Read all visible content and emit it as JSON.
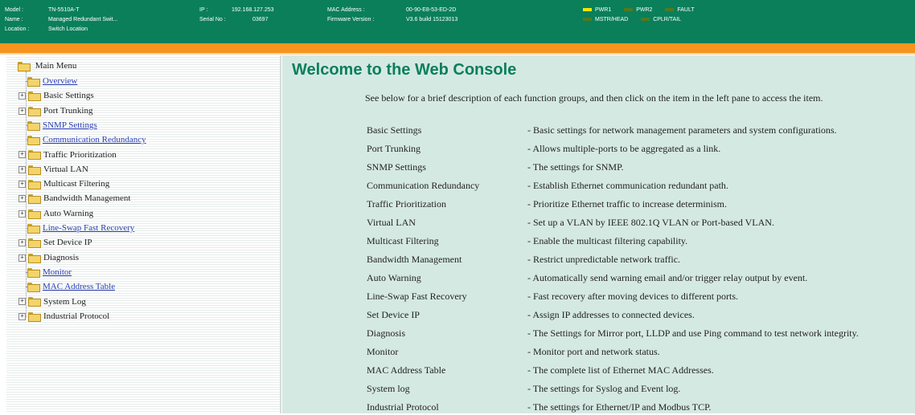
{
  "header": {
    "model_label": "Model :",
    "model_value": "TN-5510A-T",
    "name_label": "Name :",
    "name_value": "Managed Redundant Swit...",
    "location_label": "Location :",
    "location_value": "Switch Location",
    "ip_label": "IP :",
    "ip_value": "192.168.127.253",
    "serial_label": "Serial No :",
    "serial_value": "03697",
    "mac_label": "MAC Address :",
    "mac_value": "00-90-E8-53-ED-2D",
    "firmware_label": "Firmware Version :",
    "firmware_value": "V3.6 build 15123013",
    "leds": {
      "pwr1": {
        "label": "PWR1",
        "color": "#f2e600"
      },
      "pwr2": {
        "label": "PWR2",
        "color": "#4f7a20"
      },
      "fault": {
        "label": "FAULT",
        "color": "#4f7a20"
      },
      "mstr": {
        "label": "MSTR/HEAD",
        "color": "#4f7a20"
      },
      "cplr": {
        "label": "CPLR/TAIL",
        "color": "#4f7a20"
      }
    }
  },
  "sidebar": {
    "root_label": "Main Menu",
    "items": [
      {
        "label": "Overview",
        "expandable": false,
        "link": true
      },
      {
        "label": "Basic Settings",
        "expandable": true,
        "link": false
      },
      {
        "label": "Port Trunking",
        "expandable": true,
        "link": false
      },
      {
        "label": "SNMP Settings",
        "expandable": false,
        "link": true
      },
      {
        "label": "Communication Redundancy",
        "expandable": false,
        "link": true
      },
      {
        "label": "Traffic Prioritization",
        "expandable": true,
        "link": false
      },
      {
        "label": "Virtual LAN",
        "expandable": true,
        "link": false
      },
      {
        "label": "Multicast Filtering",
        "expandable": true,
        "link": false
      },
      {
        "label": "Bandwidth Management",
        "expandable": true,
        "link": false
      },
      {
        "label": "Auto Warning",
        "expandable": true,
        "link": false
      },
      {
        "label": "Line-Swap Fast Recovery",
        "expandable": false,
        "link": true
      },
      {
        "label": "Set Device IP",
        "expandable": true,
        "link": false
      },
      {
        "label": "Diagnosis",
        "expandable": true,
        "link": false
      },
      {
        "label": "Monitor",
        "expandable": false,
        "link": true
      },
      {
        "label": "MAC Address Table",
        "expandable": false,
        "link": true
      },
      {
        "label": "System Log",
        "expandable": true,
        "link": false
      },
      {
        "label": "Industrial Protocol",
        "expandable": true,
        "link": false
      }
    ]
  },
  "main": {
    "title": "Welcome to the Web Console",
    "intro": "See below for a brief description of each function groups, and then click on the item in the left pane to access the item.",
    "descriptions": [
      {
        "name": "Basic Settings",
        "text": "- Basic settings for network management parameters and system configurations."
      },
      {
        "name": "Port Trunking",
        "text": "- Allows multiple-ports to be aggregated as a link."
      },
      {
        "name": "SNMP Settings",
        "text": "- The settings for SNMP."
      },
      {
        "name": "Communication Redundancy",
        "text": "- Establish Ethernet communication redundant path."
      },
      {
        "name": "Traffic Prioritization",
        "text": "- Prioritize Ethernet traffic to increase determinism."
      },
      {
        "name": "Virtual LAN",
        "text": "- Set up a VLAN by IEEE 802.1Q VLAN or Port-based VLAN."
      },
      {
        "name": "Multicast Filtering",
        "text": "- Enable the multicast filtering capability."
      },
      {
        "name": "Bandwidth Management",
        "text": "- Restrict unpredictable network traffic."
      },
      {
        "name": "Auto Warning",
        "text": "- Automatically send warning email and/or trigger relay output by event."
      },
      {
        "name": "Line-Swap Fast Recovery",
        "text": "- Fast recovery after moving devices to different ports."
      },
      {
        "name": "Set Device IP",
        "text": "- Assign IP addresses to connected devices."
      },
      {
        "name": "Diagnosis",
        "text": "- The Settings for Mirror port, LLDP and use Ping command to test network integrity."
      },
      {
        "name": "Monitor",
        "text": "- Monitor port and network status."
      },
      {
        "name": "MAC Address Table",
        "text": "- The complete list of Ethernet MAC Addresses."
      },
      {
        "name": "System log",
        "text": "- The settings for Syslog and Event log."
      },
      {
        "name": "Industrial Protocol",
        "text": "- The settings for Ethernet/IP and Modbus TCP."
      }
    ]
  }
}
